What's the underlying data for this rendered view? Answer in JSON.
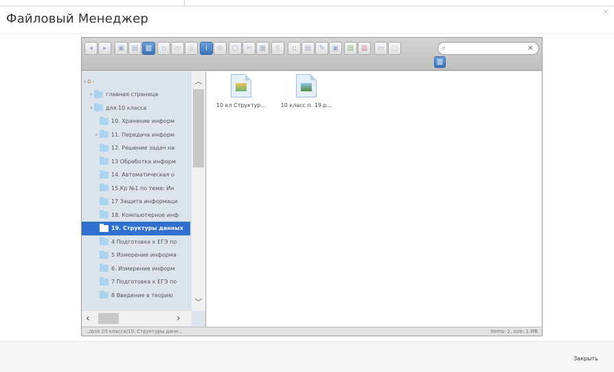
{
  "modal": {
    "title": "Файловый Менеджер",
    "close_label": "Закрыть",
    "dismiss_glyph": "×"
  },
  "search": {
    "value": "",
    "placeholder": "",
    "icon_glyph": "⌕",
    "clear_glyph": "×"
  },
  "tree": {
    "root_label": "-",
    "items": [
      {
        "label": "главная страница",
        "level": 1,
        "arrow": "▸",
        "selected": false
      },
      {
        "label": "для 10 класса",
        "level": 1,
        "arrow": "▾",
        "selected": false
      },
      {
        "label": "10. Хранение информ",
        "level": 2,
        "arrow": "",
        "selected": false
      },
      {
        "label": "11. Передача информ",
        "level": 2,
        "arrow": "▸",
        "selected": false
      },
      {
        "label": "12. Решение задач на",
        "level": 2,
        "arrow": "",
        "selected": false
      },
      {
        "label": "13 Обработка информ",
        "level": 2,
        "arrow": "",
        "selected": false
      },
      {
        "label": "14. Автоматическая о",
        "level": 2,
        "arrow": "",
        "selected": false
      },
      {
        "label": "15.Кр №1 по теме: Ин",
        "level": 2,
        "arrow": "",
        "selected": false
      },
      {
        "label": "17 Защита информаци",
        "level": 2,
        "arrow": "",
        "selected": false
      },
      {
        "label": "18. Компьютерное инф",
        "level": 2,
        "arrow": "",
        "selected": false
      },
      {
        "label": "19. Структуры данных",
        "level": 2,
        "arrow": "",
        "selected": true
      },
      {
        "label": "4 Подготовка к ЕГЭ по",
        "level": 2,
        "arrow": "",
        "selected": false
      },
      {
        "label": "5 Измерение информа",
        "level": 2,
        "arrow": "",
        "selected": false
      },
      {
        "label": "6. Измерение информ",
        "level": 2,
        "arrow": "",
        "selected": false
      },
      {
        "label": "7 Подготовка к ЕГЭ по",
        "level": 2,
        "arrow": "",
        "selected": false
      },
      {
        "label": "8 Введение в теорию",
        "level": 2,
        "arrow": "",
        "selected": false
      }
    ]
  },
  "files": [
    {
      "name": "10 кл Структур...",
      "icon": "presentation-file-icon"
    },
    {
      "name": "10 класс п. 19.р...",
      "icon": "image-file-icon"
    }
  ],
  "status": {
    "path": "../для 10 класса/19. Структуры данн...",
    "info": "Items: 2, size: 1 MB"
  }
}
